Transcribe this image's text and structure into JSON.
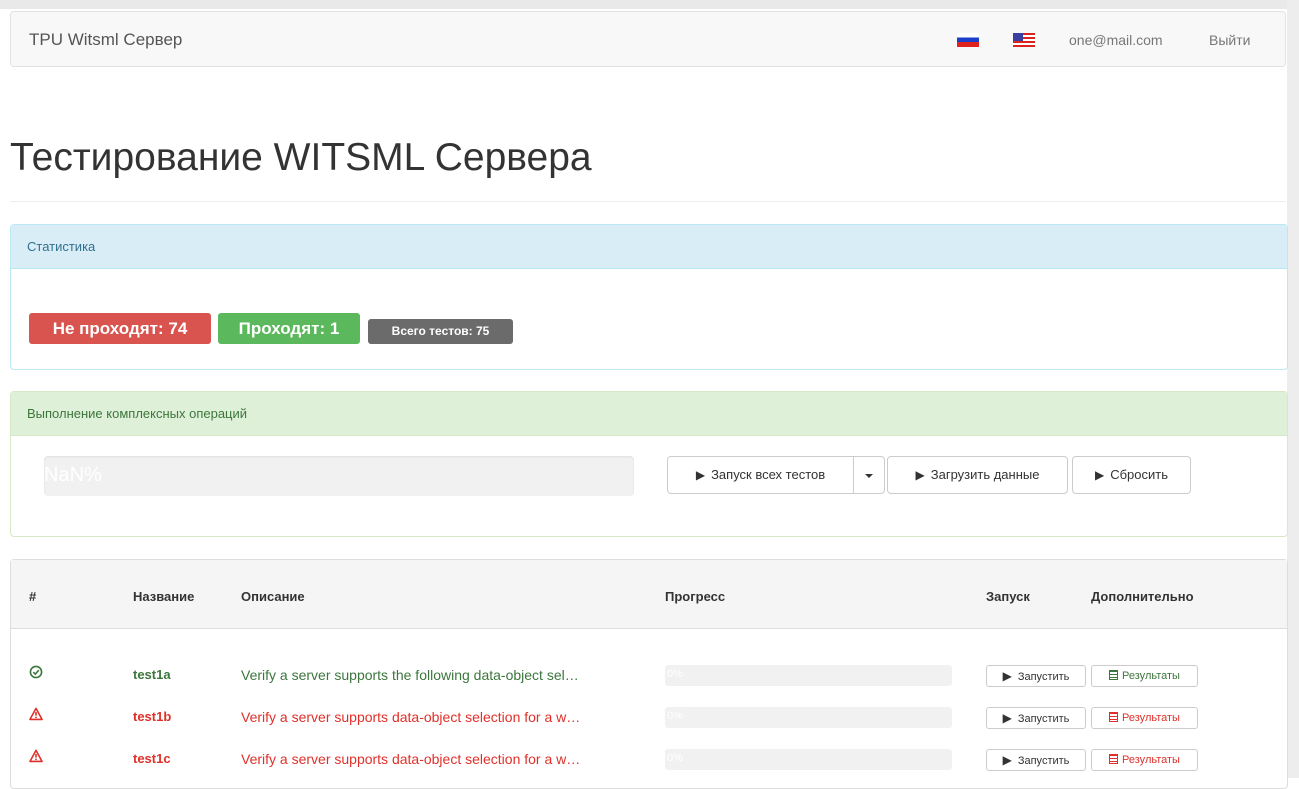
{
  "navbar": {
    "brand": "TPU Witsml Сервер",
    "flags": [
      "flag-ru-icon",
      "flag-us-icon"
    ],
    "email": "one@mail.com",
    "logout": "Выйти"
  },
  "page_title": "Тестирование WITSML Сервера",
  "stats_panel": {
    "heading": "Статистика",
    "failing": "Не проходят: 74",
    "passing": "Проходят: 1",
    "total": "Всего тестов: 75"
  },
  "operations_panel": {
    "heading": "Выполнение комплексных операций",
    "progress_text": "NaN%",
    "run_all": "Запуск всех тестов",
    "load_data": "Загрузить данные",
    "reset": "Сбросить"
  },
  "table": {
    "headers": [
      "#",
      "Название",
      "Описание",
      "Прогресс",
      "Запуск",
      "Дополнительно"
    ],
    "rows": [
      {
        "status": "pass",
        "status_icon": "check-circle-icon",
        "name": "test1a",
        "description": "Verify a server supports the following data-object sel…",
        "progress": "0%",
        "progress_value": 0,
        "run": "Запустить",
        "results": "Результаты"
      },
      {
        "status": "fail",
        "status_icon": "warning-triangle-icon",
        "name": "test1b",
        "description": "Verify a server supports data-object selection for a w…",
        "progress": "0%",
        "progress_value": 0,
        "run": "Запустить",
        "results": "Результаты"
      },
      {
        "status": "fail",
        "status_icon": "warning-triangle-icon",
        "name": "test1c",
        "description": "Verify a server supports data-object selection for a w…",
        "progress": "0%",
        "progress_value": 0,
        "run": "Запустить",
        "results": "Результаты"
      }
    ]
  },
  "colors": {
    "danger": "#d9534f",
    "success": "#5cb85c",
    "default_badge": "#6b6b6b",
    "info_bg": "#d9edf7",
    "success_bg": "#dff0d8"
  }
}
